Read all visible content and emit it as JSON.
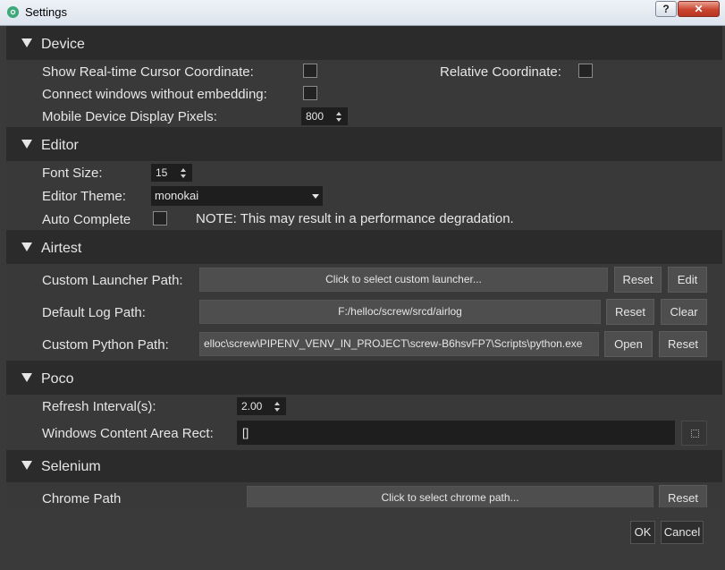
{
  "window": {
    "title": "Settings",
    "help_label": "?",
    "close_label": "✕"
  },
  "device": {
    "header": "Device",
    "show_cursor_label": "Show Real-time Cursor Coordinate:",
    "relative_label": "Relative Coordinate:",
    "connect_label": "Connect windows without embedding:",
    "mobile_pixels_label": "Mobile Device Display Pixels:",
    "mobile_pixels_value": "800"
  },
  "editor": {
    "header": "Editor",
    "font_size_label": "Font Size:",
    "font_size_value": "15",
    "theme_label": "Editor Theme:",
    "theme_value": "monokai",
    "auto_complete_label": "Auto Complete",
    "note": "NOTE: This may result in a performance degradation."
  },
  "airtest": {
    "header": "Airtest",
    "launcher_label": "Custom Launcher Path:",
    "launcher_value": "Click to select custom launcher...",
    "launcher_reset": "Reset",
    "launcher_edit": "Edit",
    "log_label": "Default Log Path:",
    "log_value": "F:/helloc/screw/srcd/airlog",
    "log_reset": "Reset",
    "log_clear": "Clear",
    "python_label": "Custom Python Path:",
    "python_value": "elloc\\screw\\PIPENV_VENV_IN_PROJECT\\screw-B6hsvFP7\\Scripts\\python.exe",
    "python_open": "Open",
    "python_reset": "Reset"
  },
  "poco": {
    "header": "Poco",
    "refresh_label": "Refresh Interval(s):",
    "refresh_value": "2.00",
    "rect_label": "Windows Content Area Rect:",
    "rect_value": "[]"
  },
  "selenium": {
    "header": "Selenium",
    "chrome_label": "Chrome Path",
    "chrome_value": "Click to select chrome path...",
    "chrome_reset": "Reset"
  },
  "footer": {
    "ok_label": "OK",
    "cancel_label": "Cancel"
  }
}
